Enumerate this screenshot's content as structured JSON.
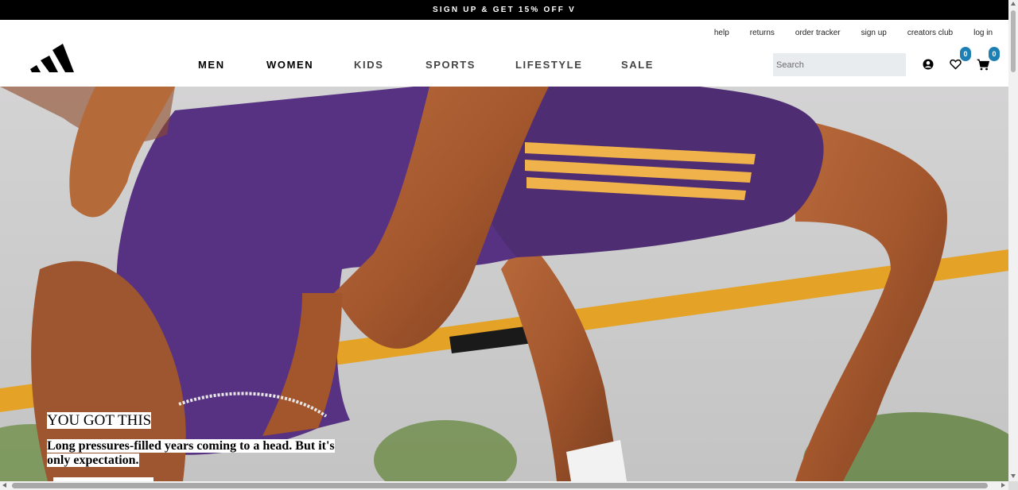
{
  "promo": {
    "text": "SIGN UP & GET 15% OFF V"
  },
  "utility_links": [
    "help",
    "returns",
    "order tracker",
    "sign up",
    "creators club",
    "log in"
  ],
  "nav": [
    "MEN",
    "WOMEN",
    "KIDS",
    "SPORTS",
    "LIFESTYLE",
    "SALE"
  ],
  "search": {
    "placeholder": "Search",
    "value": ""
  },
  "icons": {
    "account": "account-icon",
    "wishlist": "heart-icon",
    "cart": "cart-icon",
    "logo": "adidas-logo"
  },
  "wishlist_count": "0",
  "cart_count": "0",
  "hero": {
    "title": "YOU GOT THIS",
    "subtitle": "Long pressures-filled years coming to a head. But it's only expectation."
  },
  "colors": {
    "promo_bg": "#000000",
    "badge": "#1d7fb3",
    "search_bg": "#e9ecef"
  }
}
